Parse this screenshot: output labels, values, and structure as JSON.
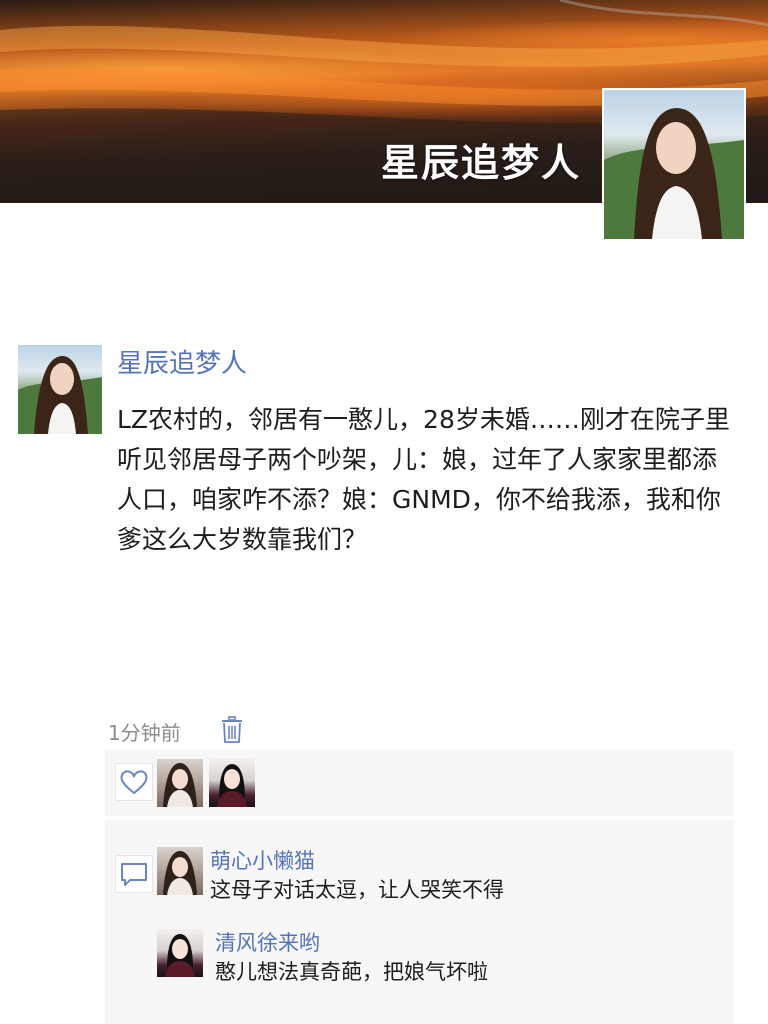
{
  "profile": {
    "cover_name": "星辰追梦人",
    "avatar_icon": "woman-portrait-avatar"
  },
  "post": {
    "author": "星辰追梦人",
    "text": "LZ农村的，邻居有一憨儿，28岁未婚……刚才在院子里听见邻居母子两个吵架，儿：娘，过年了人家家里都添人口，咱家咋不添？娘：GNMD，你不给我添，我和你爹这么大岁数靠我们？",
    "time": "1分钟前",
    "delete_icon": "trash-icon"
  },
  "likes": {
    "icon": "heart-icon",
    "avatars": [
      "woman-avatar-1",
      "woman-avatar-2"
    ]
  },
  "comments": {
    "icon": "comment-icon",
    "items": [
      {
        "author": "萌心小懒猫",
        "text": "这母子对话太逗，让人哭笑不得"
      },
      {
        "author": "清风徐来哟",
        "text": "憨儿想法真奇葩，把娘气坏啦"
      }
    ]
  },
  "colors": {
    "link": "#5574b8",
    "text": "#1d1d1d",
    "muted": "#8c8c8c",
    "panel": "#f7f7f7"
  }
}
